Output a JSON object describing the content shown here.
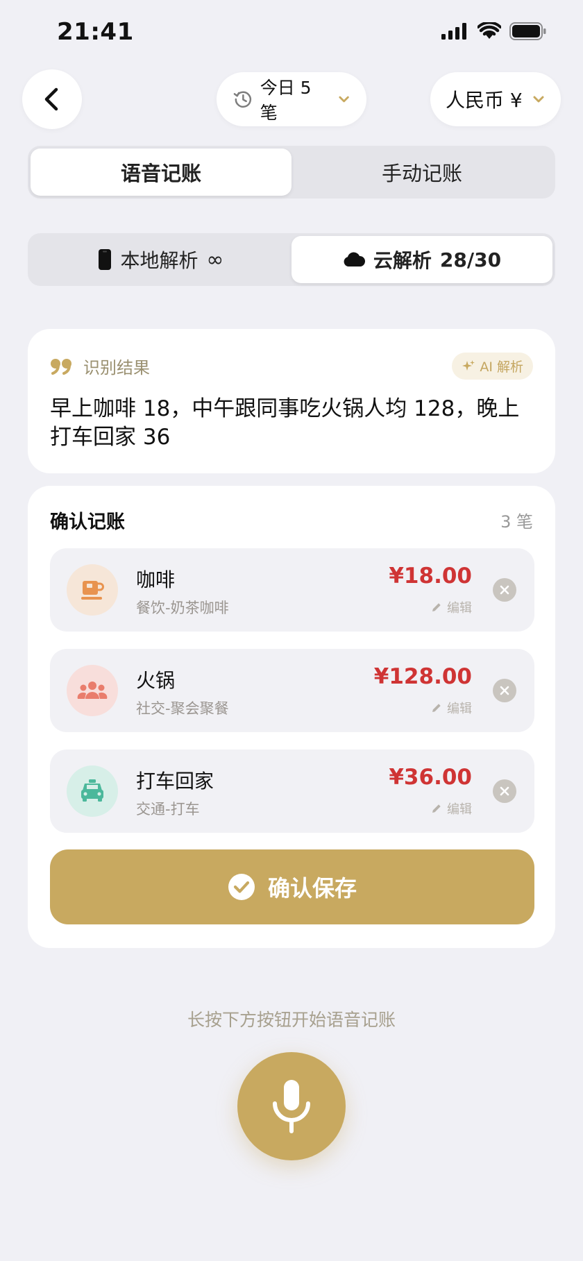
{
  "status_bar": {
    "time": "21:41"
  },
  "header": {
    "today_label": "今日 5 笔",
    "currency_label": "人民币 ¥"
  },
  "mode_tabs": [
    {
      "label": "语音记账",
      "active": true
    },
    {
      "label": "手动记账",
      "active": false
    }
  ],
  "parse_tabs": [
    {
      "label": "本地解析",
      "quota": "∞",
      "active": false,
      "icon": "phone-icon"
    },
    {
      "label": "云解析",
      "quota": "28/30",
      "active": true,
      "icon": "cloud-icon"
    }
  ],
  "recognition": {
    "title": "识别结果",
    "ai_badge": "AI 解析",
    "text": "早上咖啡 18，中午跟同事吃火锅人均 128，晚上打车回家 36"
  },
  "confirm": {
    "title": "确认记账",
    "count": "3 笔",
    "entries": [
      {
        "name": "咖啡",
        "category": "餐饮-奶茶咖啡",
        "amount": "¥18.00",
        "edit": "编辑",
        "icon": "coffee-icon",
        "color": "#e8934f",
        "bg": "#f6e6d8"
      },
      {
        "name": "火锅",
        "category": "社交-聚会聚餐",
        "amount": "¥128.00",
        "edit": "编辑",
        "icon": "people-icon",
        "color": "#e97d6c",
        "bg": "#f8dedb"
      },
      {
        "name": "打车回家",
        "category": "交通-打车",
        "amount": "¥36.00",
        "edit": "编辑",
        "icon": "taxi-icon",
        "color": "#4bb89b",
        "bg": "#d7efe8"
      }
    ],
    "save_label": "确认保存"
  },
  "hint": "长按下方按钮开始语音记账",
  "colors": {
    "accent": "#c8a960",
    "amount": "#cf3434",
    "background": "#f0f0f5"
  }
}
